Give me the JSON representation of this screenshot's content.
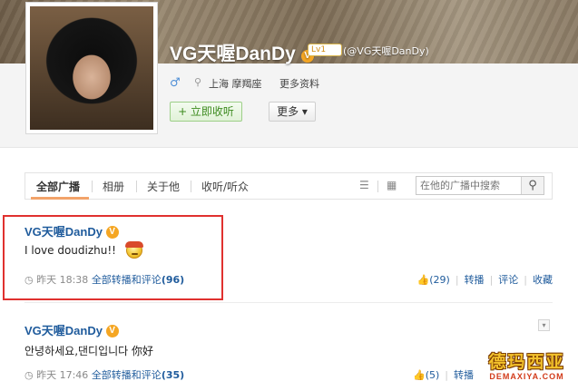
{
  "profile": {
    "name": "VG天喔DanDy",
    "verified_badge": "V",
    "level": "Lv1",
    "handle": "(@VG天喔DanDy)",
    "gender_icon": "♂",
    "location": "上海 摩羯座",
    "more_info": "更多资料",
    "follow_button": "+ 立即收听",
    "more_button": "更多 ▾"
  },
  "tabs": {
    "items": [
      "全部广播",
      "相册",
      "关于他",
      "收听/听众"
    ],
    "active_index": 0,
    "search_placeholder": "在他的广播中搜索"
  },
  "posts": [
    {
      "author": "VG天喔DanDy",
      "text": "I love doudizhu!!",
      "time": "昨天 18:38",
      "thread_label": "全部转播和评论",
      "thread_count": "(96)",
      "likes": "(29)",
      "actions": [
        "转播",
        "评论",
        "收藏"
      ]
    },
    {
      "author": "VG天喔DanDy",
      "text": "안녕하세요,댄디입니다 你好",
      "time": "昨天 17:46",
      "thread_label": "全部转播和评论",
      "thread_count": "(35)",
      "likes": "(5)",
      "actions": [
        "转播"
      ]
    }
  ],
  "watermark": {
    "main": "德玛西亚",
    "sub": "DEMAXIYA.COM"
  },
  "colors": {
    "link": "#1f5b9c",
    "highlight": "#e0312f",
    "follow_green": "#3d8b1f"
  }
}
